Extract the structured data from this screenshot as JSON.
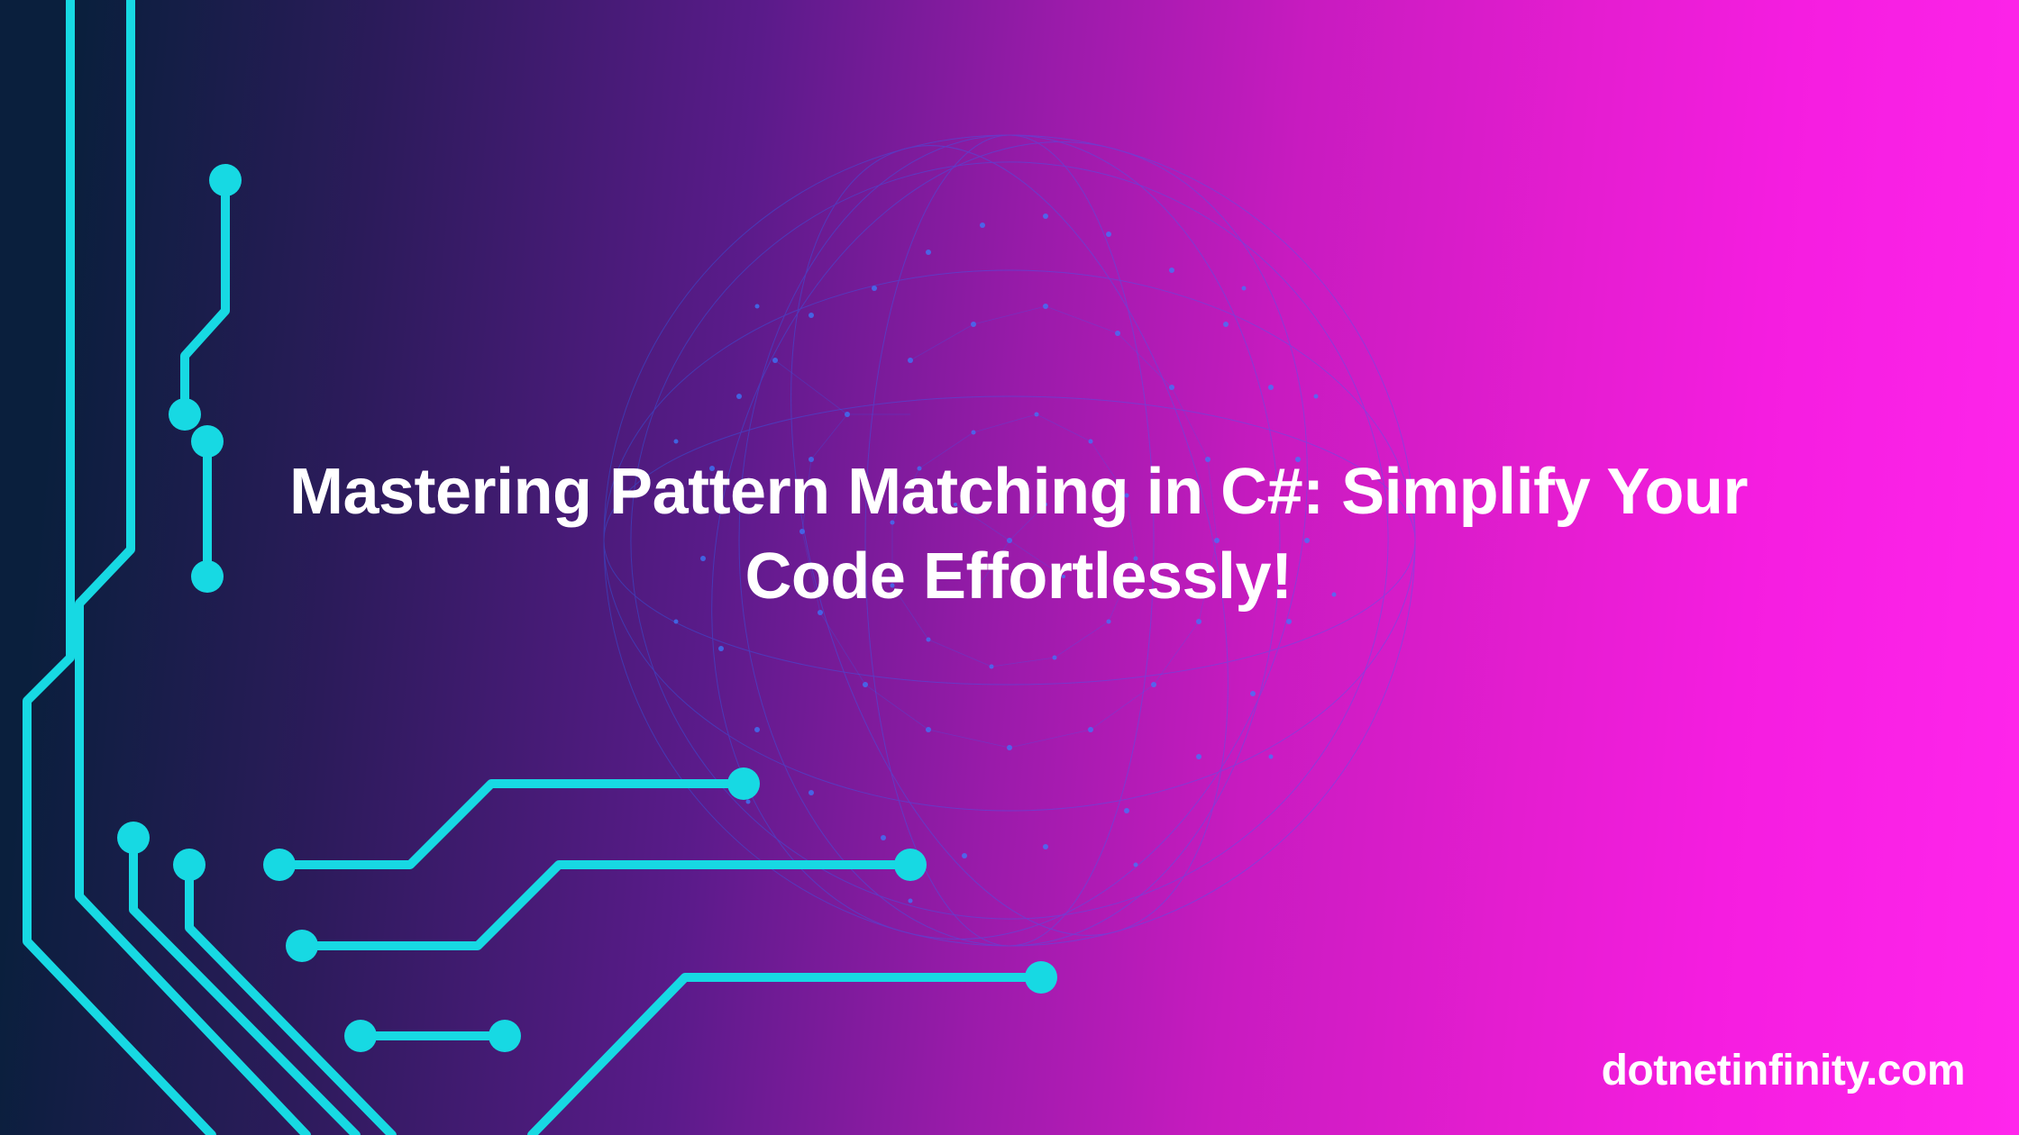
{
  "title": "Mastering Pattern Matching in C#: Simplify Your Code Effortlessly!",
  "site": "dotnetinfinity.com",
  "colors": {
    "circuit": "#17d9e3",
    "globe": "#2a6bff",
    "text": "#ffffff"
  }
}
